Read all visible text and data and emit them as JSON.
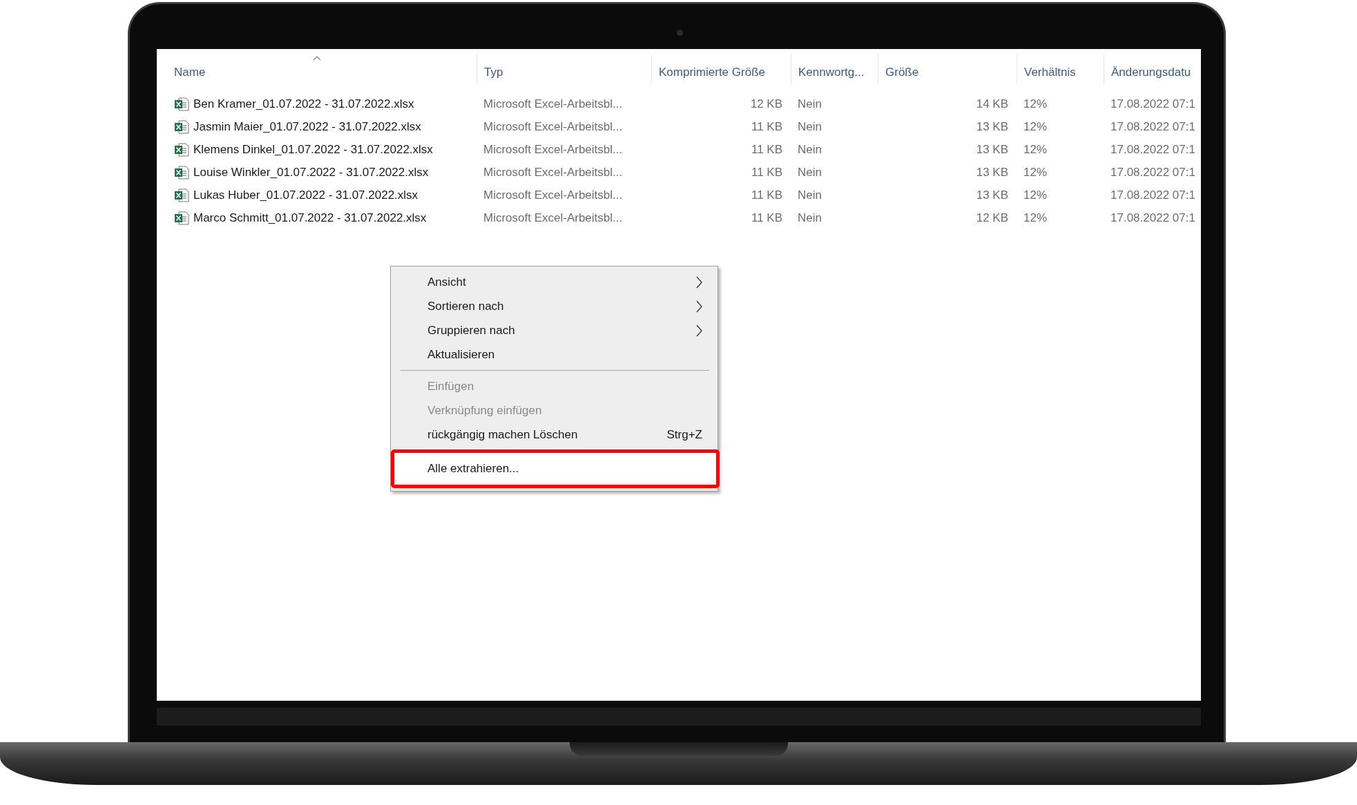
{
  "file_list": {
    "columns": [
      {
        "label": "Name",
        "sorted": true
      },
      {
        "label": "Typ",
        "sorted": false
      },
      {
        "label": "Komprimierte Größe",
        "sorted": false
      },
      {
        "label": "Kennwortg...",
        "sorted": false
      },
      {
        "label": "Größe",
        "sorted": false
      },
      {
        "label": "Verhältnis",
        "sorted": false
      },
      {
        "label": "Änderungsdatu",
        "sorted": false
      }
    ],
    "rows": [
      [
        "Ben Kramer_01.07.2022 - 31.07.2022.xlsx",
        "Microsoft Excel-Arbeitsbl...",
        "12 KB",
        "Nein",
        "14 KB",
        "12%",
        "17.08.2022 07:1"
      ],
      [
        "Jasmin Maier_01.07.2022 - 31.07.2022.xlsx",
        "Microsoft Excel-Arbeitsbl...",
        "11 KB",
        "Nein",
        "13 KB",
        "12%",
        "17.08.2022 07:1"
      ],
      [
        "Klemens Dinkel_01.07.2022 - 31.07.2022.xlsx",
        "Microsoft Excel-Arbeitsbl...",
        "11 KB",
        "Nein",
        "13 KB",
        "12%",
        "17.08.2022 07:1"
      ],
      [
        "Louise Winkler_01.07.2022 - 31.07.2022.xlsx",
        "Microsoft Excel-Arbeitsbl...",
        "11 KB",
        "Nein",
        "13 KB",
        "12%",
        "17.08.2022 07:1"
      ],
      [
        "Lukas Huber_01.07.2022 - 31.07.2022.xlsx",
        "Microsoft Excel-Arbeitsbl...",
        "11 KB",
        "Nein",
        "13 KB",
        "12%",
        "17.08.2022 07:1"
      ],
      [
        "Marco Schmitt_01.07.2022 - 31.07.2022.xlsx",
        "Microsoft Excel-Arbeitsbl...",
        "11 KB",
        "Nein",
        "12 KB",
        "12%",
        "17.08.2022 07:1"
      ]
    ]
  },
  "context_menu": {
    "items": [
      {
        "kind": "submenu",
        "label": "Ansicht",
        "disabled": false,
        "highlighted": false
      },
      {
        "kind": "submenu",
        "label": "Sortieren nach",
        "disabled": false,
        "highlighted": false
      },
      {
        "kind": "submenu",
        "label": "Gruppieren nach",
        "disabled": false,
        "highlighted": false
      },
      {
        "kind": "command",
        "label": "Aktualisieren",
        "disabled": false,
        "highlighted": false
      },
      {
        "kind": "separator"
      },
      {
        "kind": "command",
        "label": "Einfügen",
        "disabled": true,
        "highlighted": false
      },
      {
        "kind": "command",
        "label": "Verknüpfung einfügen",
        "disabled": true,
        "highlighted": false
      },
      {
        "kind": "command",
        "label": "rückgängig machen Löschen",
        "shortcut": "Strg+Z",
        "disabled": false,
        "highlighted": false
      },
      {
        "kind": "separator"
      },
      {
        "kind": "command",
        "label": "Alle extrahieren...",
        "disabled": false,
        "highlighted": true
      }
    ]
  }
}
